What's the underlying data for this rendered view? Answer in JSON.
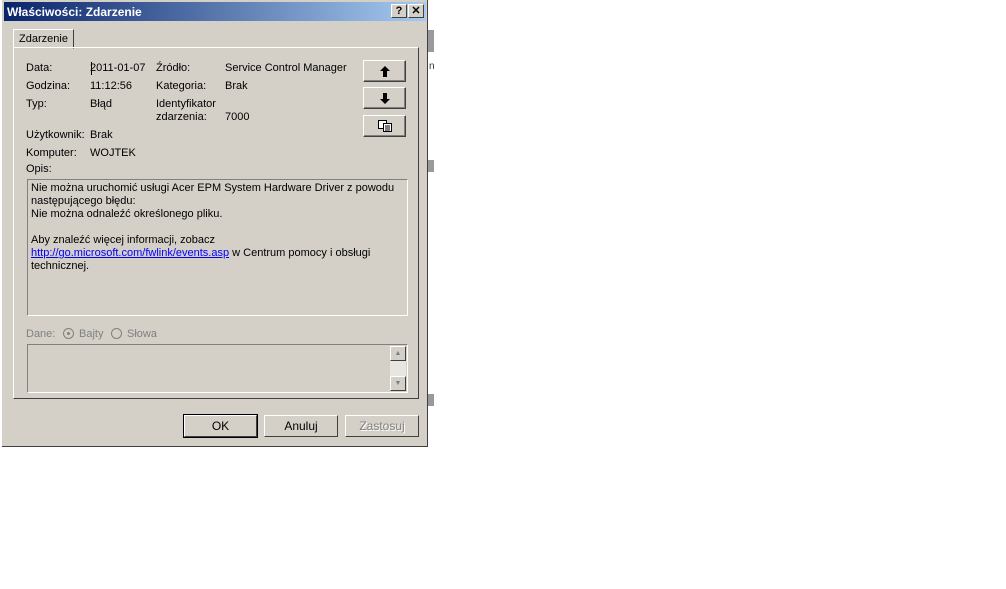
{
  "window": {
    "title": "Właściwości: Zdarzenie",
    "help_btn": "?",
    "close_btn": "✕"
  },
  "tab": {
    "label": "Zdarzenie"
  },
  "fields": {
    "data_label": "Data:",
    "data_value": "2011-01-07",
    "zrodlo_label": "Źródło:",
    "zrodlo_value": "Service Control Manager",
    "godzina_label": "Godzina:",
    "godzina_value": "11:12:56",
    "kategoria_label": "Kategoria:",
    "kategoria_value": "Brak",
    "typ_label": "Typ:",
    "typ_value": "Błąd",
    "ident_label_1": "Identyfikator",
    "ident_label_2": "zdarzenia:",
    "ident_value": "7000",
    "uzytkownik_label": "Użytkownik:",
    "uzytkownik_value": "Brak",
    "komputer_label": "Komputer:",
    "komputer_value": "WOJTEK",
    "opis_label": "Opis:"
  },
  "description": {
    "line1": "Nie można uruchomić usługi Acer EPM System Hardware Driver z powodu",
    "line2": "następującego błędu:",
    "line3": "Nie można odnaleźć określonego pliku.",
    "line4": "",
    "line5": "Aby znaleźć więcej informacji, zobacz",
    "link": "http://go.microsoft.com/fwlink/events.asp",
    "line6_after_link": " w Centrum pomocy i obsługi",
    "line7": "technicznej."
  },
  "data_section": {
    "label": "Dane:",
    "option_bytes": "Bajty",
    "option_words": "Słowa"
  },
  "buttons": {
    "ok": "OK",
    "cancel": "Anuluj",
    "apply": "Zastosuj"
  }
}
